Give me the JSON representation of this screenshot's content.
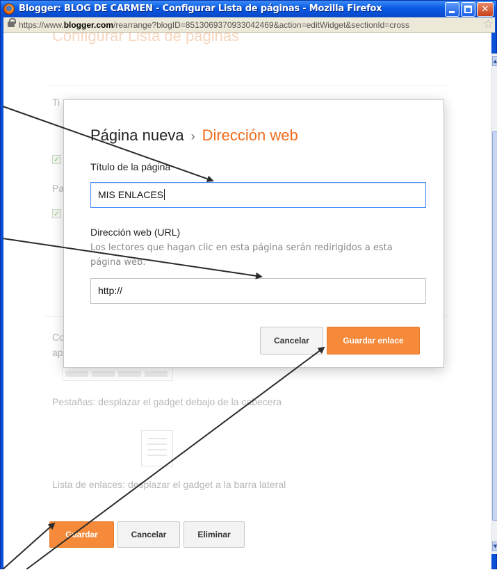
{
  "window": {
    "title": "Blogger: BLOG DE CARMEN - Configurar Lista de páginas - Mozilla Firefox",
    "url_prefix": "https://www.",
    "url_domain": "blogger.com",
    "url_rest": "/rearrange?blogID=8513069370933042469&action=editWidget&sectionId=cross"
  },
  "background_page": {
    "heading": "Configurar Lista de páginas",
    "title_label_fragment": "Ti",
    "pages_label_fragment": "Pa",
    "info_fragment_1": "Co",
    "info_fragment_2": "ap",
    "tabs_caption": "Pestañas: desplazar el gadget debajo de la cabecera",
    "list_caption": "Lista de enlaces: desplazar el gadget a la barra lateral",
    "save_label": "Guardar",
    "cancel_label": "Cancelar",
    "delete_label": "Eliminar"
  },
  "dialog": {
    "breadcrumb_parent": "Página nueva",
    "breadcrumb_separator": "›",
    "breadcrumb_current": "Dirección web",
    "page_title_label": "Título de la página",
    "page_title_value": "MIS ENLACES",
    "url_label": "Dirección web (URL)",
    "url_hint": "Los lectores que hagan clic en esta página serán redirigidos a esta página web.",
    "url_value": "http://",
    "cancel_label": "Cancelar",
    "save_label": "Guardar enlace"
  },
  "colors": {
    "accent_orange": "#f58a3a",
    "breadcrumb_orange": "#ef6a1c",
    "focus_blue": "#4d90fe",
    "titlebar_blue": "#0a5ae4"
  }
}
